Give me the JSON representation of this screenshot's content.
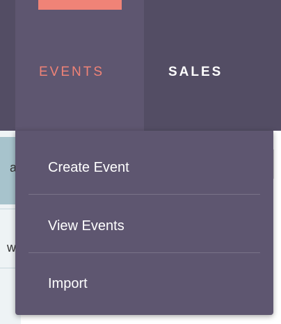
{
  "nav": {
    "events_label": "EVENTS",
    "sales_label": "SALES"
  },
  "dropdown": {
    "items": [
      {
        "label": "Create Event"
      },
      {
        "label": "View Events"
      },
      {
        "label": "Import"
      }
    ]
  },
  "background": {
    "fragments": [
      "a",
      "w"
    ]
  },
  "colors": {
    "navbar": "#534d64",
    "nav_active": "#5e5670",
    "accent": "#f08377",
    "dropdown_bg": "#5e5670",
    "text": "#ffffff"
  }
}
